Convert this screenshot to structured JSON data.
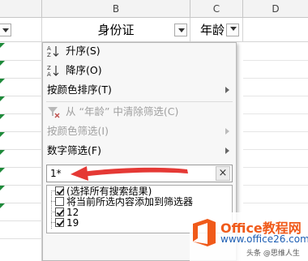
{
  "columns": {
    "b": "B",
    "c": "C",
    "d": "D"
  },
  "header": {
    "id_card": "身份证",
    "age": "年龄"
  },
  "menu": {
    "sort_asc": "升序(S)",
    "sort_desc": "降序(O)",
    "sort_by_color": "按颜色排序(T)",
    "clear_filter": "从 “年龄” 中清除筛选(C)",
    "filter_by_color": "按颜色筛选(I)",
    "number_filters": "数字筛选(F)"
  },
  "search": {
    "value": "1*"
  },
  "list": {
    "items": [
      {
        "label": "(选择所有搜索结果)",
        "checked": true
      },
      {
        "label": "将当前所选内容添加到筛选器",
        "checked": false
      },
      {
        "label": "12",
        "checked": true
      },
      {
        "label": "19",
        "checked": true
      }
    ]
  },
  "watermark": {
    "brand": "Office教程网",
    "url": "www.office26.com",
    "credit": "头条 @思维人生"
  },
  "colors": {
    "arrow": "#e53935",
    "logo_orange": "#f05a1a",
    "logo_blue": "#1e5fb4"
  },
  "icons": [
    "sort-ascending-icon",
    "sort-descending-icon",
    "clear-filter-icon",
    "submenu-arrow-icon",
    "clear-search-icon",
    "dropdown-icon"
  ]
}
